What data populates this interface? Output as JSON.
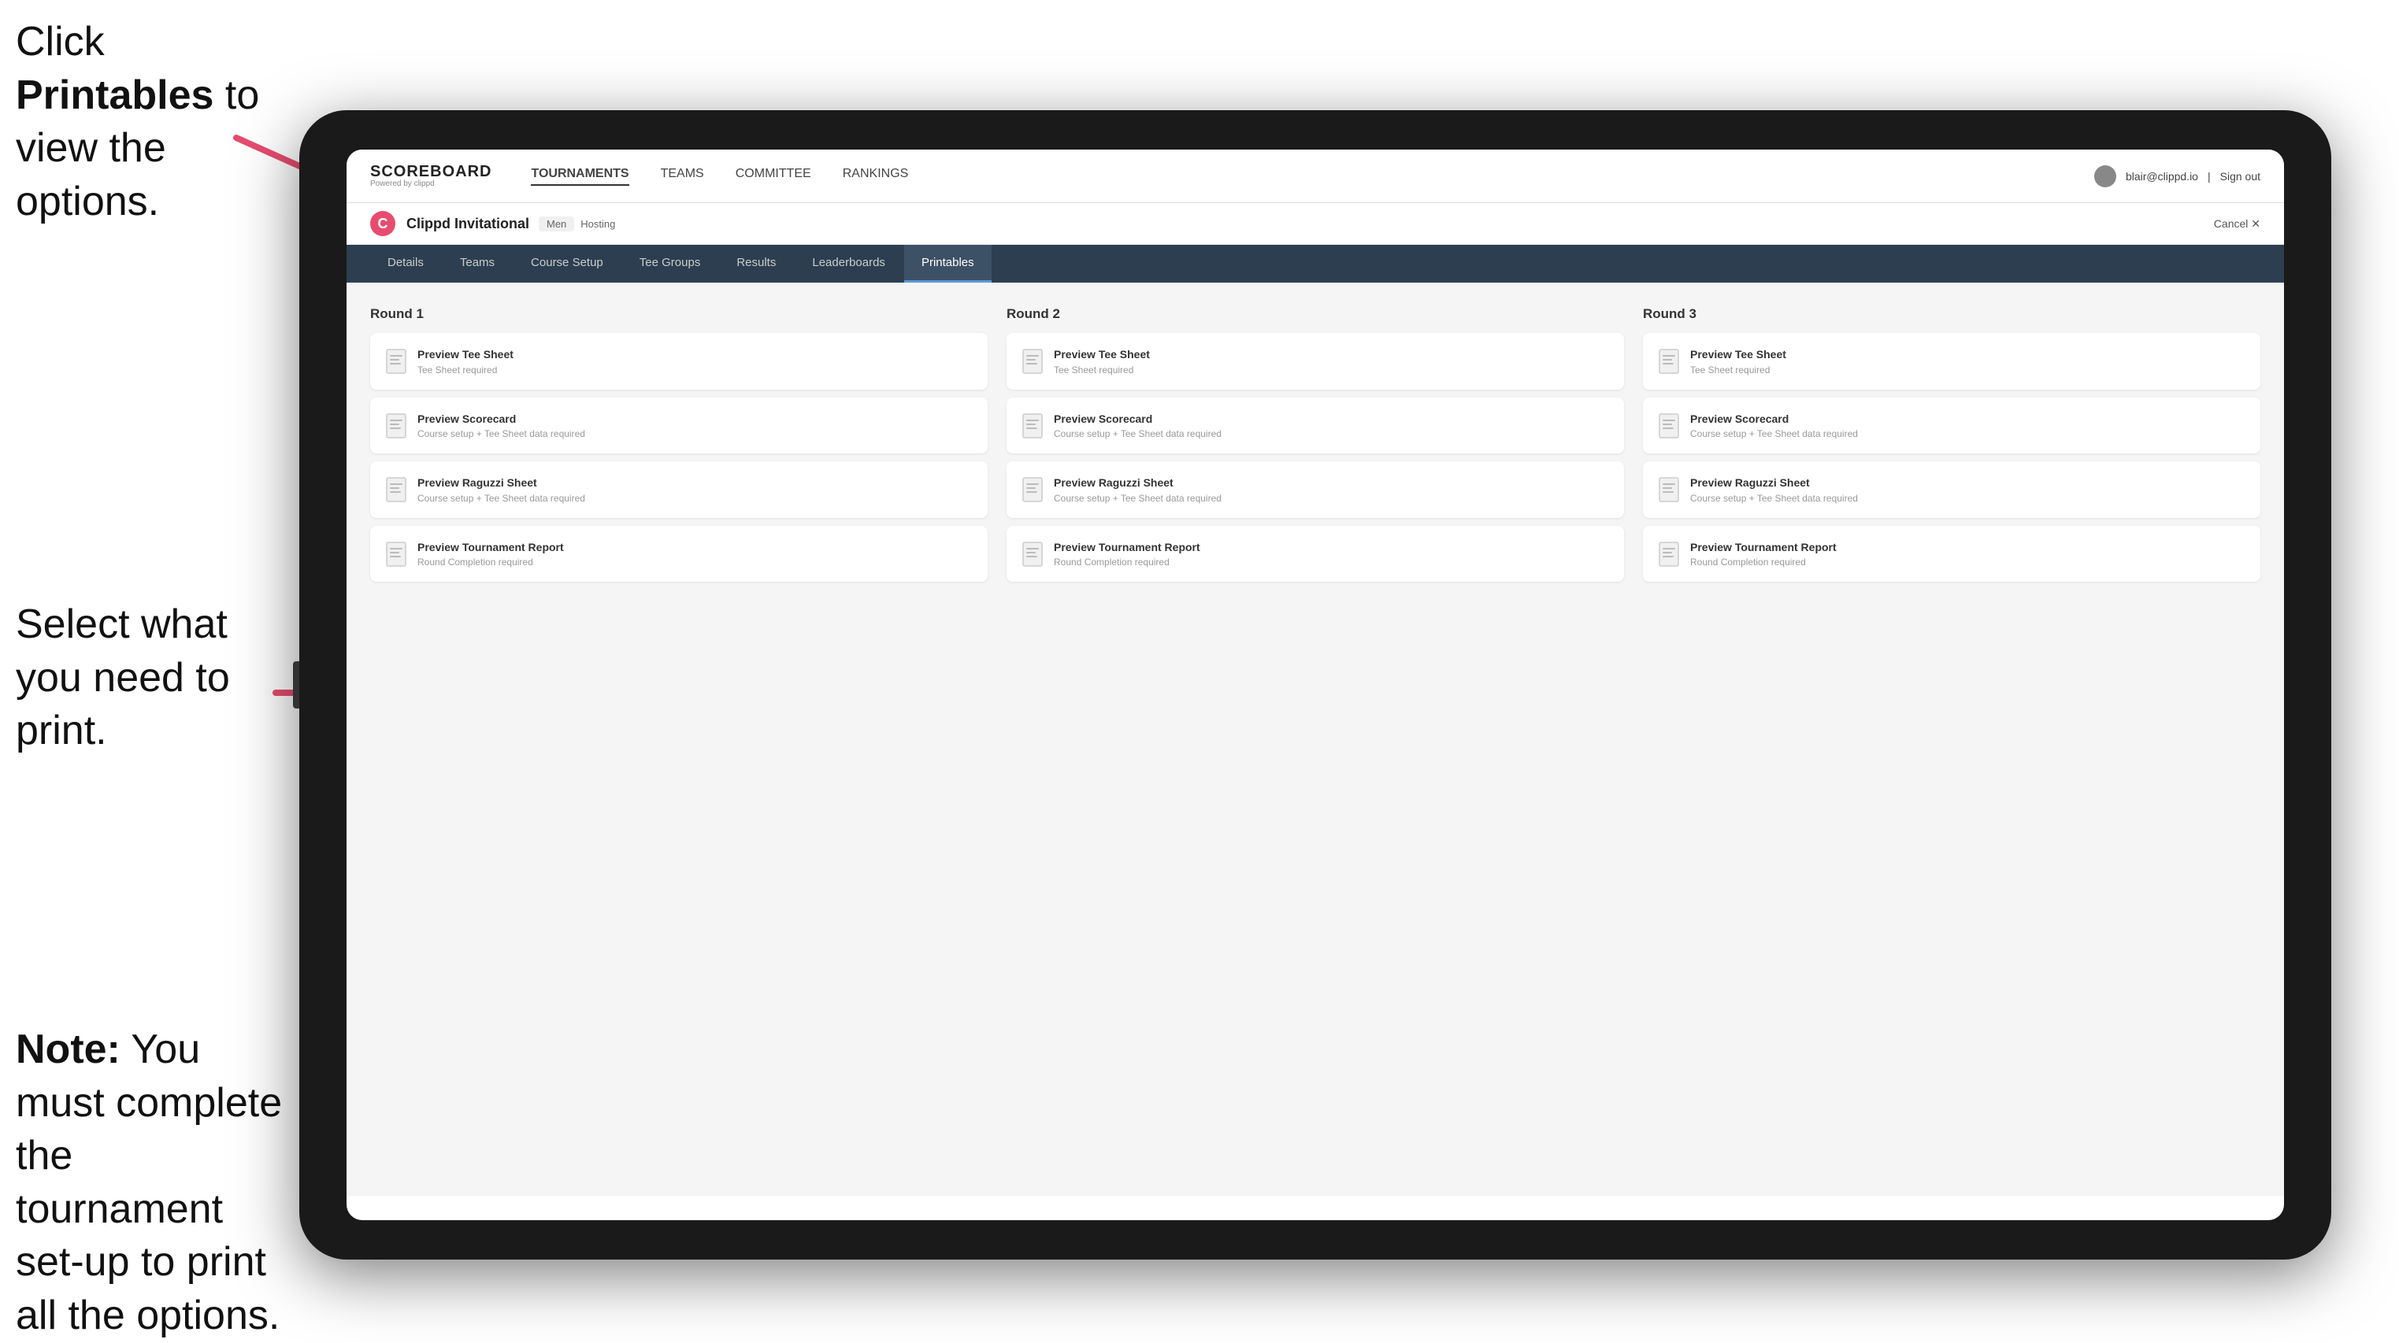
{
  "annotations": {
    "top_text_line1": "Click ",
    "top_text_bold": "Printables",
    "top_text_line2": " to",
    "top_text_line3": "view the options.",
    "middle_text_line1": "Select what you",
    "middle_text_line2": "need to print.",
    "bottom_text_note": "Note:",
    "bottom_text_rest": " You must complete the tournament set-up to print all the options."
  },
  "app": {
    "logo_title": "SCOREBOARD",
    "logo_sub": "Powered by clippd",
    "nav_links": [
      "TOURNAMENTS",
      "TEAMS",
      "COMMITTEE",
      "RANKINGS"
    ],
    "user_email": "blair@clippd.io",
    "sign_out": "Sign out"
  },
  "sub_header": {
    "logo_letter": "C",
    "tournament_name": "Clippd Invitational",
    "badge": "Men",
    "status": "Hosting",
    "cancel": "Cancel ✕"
  },
  "tabs": [
    {
      "label": "Details"
    },
    {
      "label": "Teams"
    },
    {
      "label": "Course Setup"
    },
    {
      "label": "Tee Groups"
    },
    {
      "label": "Results"
    },
    {
      "label": "Leaderboards"
    },
    {
      "label": "Printables",
      "active": true
    }
  ],
  "rounds": [
    {
      "title": "Round 1",
      "items": [
        {
          "title": "Preview Tee Sheet",
          "sub": "Tee Sheet required"
        },
        {
          "title": "Preview Scorecard",
          "sub": "Course setup + Tee Sheet data required"
        },
        {
          "title": "Preview Raguzzi Sheet",
          "sub": "Course setup + Tee Sheet data required"
        },
        {
          "title": "Preview Tournament Report",
          "sub": "Round Completion required"
        }
      ]
    },
    {
      "title": "Round 2",
      "items": [
        {
          "title": "Preview Tee Sheet",
          "sub": "Tee Sheet required"
        },
        {
          "title": "Preview Scorecard",
          "sub": "Course setup + Tee Sheet data required"
        },
        {
          "title": "Preview Raguzzi Sheet",
          "sub": "Course setup + Tee Sheet data required"
        },
        {
          "title": "Preview Tournament Report",
          "sub": "Round Completion required"
        }
      ]
    },
    {
      "title": "Round 3",
      "items": [
        {
          "title": "Preview Tee Sheet",
          "sub": "Tee Sheet required"
        },
        {
          "title": "Preview Scorecard",
          "sub": "Course setup + Tee Sheet data required"
        },
        {
          "title": "Preview Raguzzi Sheet",
          "sub": "Course setup + Tee Sheet data required"
        },
        {
          "title": "Preview Tournament Report",
          "sub": "Round Completion required"
        }
      ]
    }
  ]
}
